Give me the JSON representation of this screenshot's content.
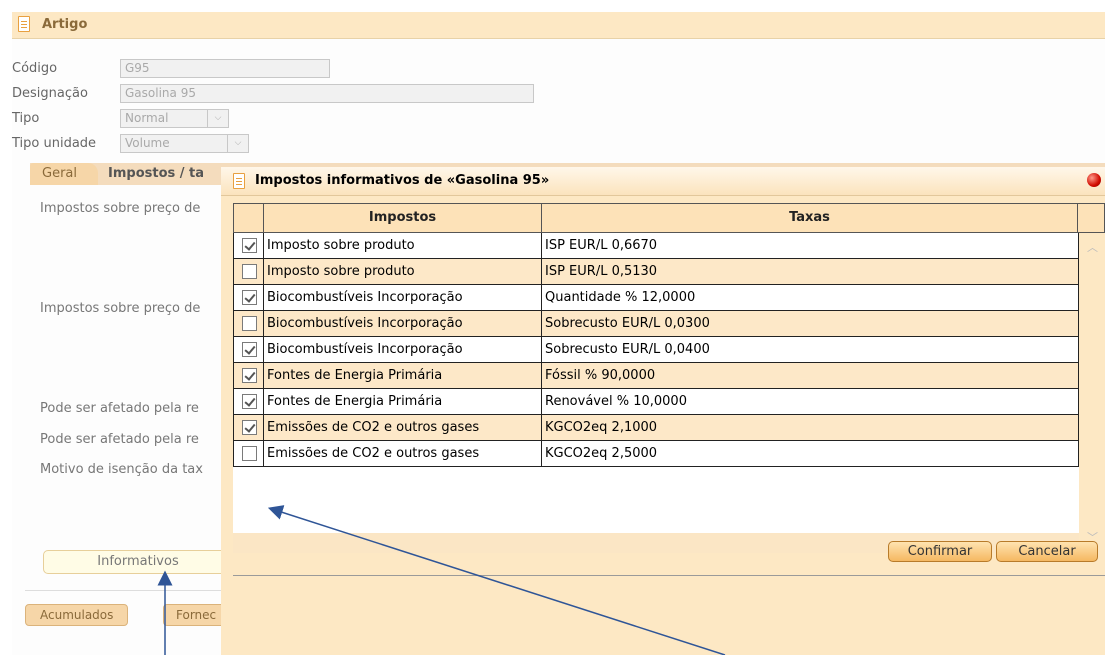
{
  "main": {
    "title": "Artigo",
    "fields": {
      "codigo_label": "Código",
      "codigo_value": "G95",
      "designacao_label": "Designação",
      "designacao_value": "Gasolina 95",
      "tipo_label": "Tipo",
      "tipo_value": "Normal",
      "tipo_unidade_label": "Tipo unidade",
      "tipo_unidade_value": "Volume"
    },
    "tabs": {
      "geral": "Geral",
      "impostos": "Impostos / ta"
    },
    "labels": {
      "impostos1": "Impostos sobre preço de",
      "impostos2": "Impostos sobre preço de",
      "afetado1": "Pode ser afetado pela re",
      "afetado2": "Pode ser afetado pela re",
      "motivo": "Motivo de isenção da tax"
    },
    "informativos_button": "Informativos",
    "bottom_tabs": {
      "acumulados": "Acumulados",
      "fornec": "Fornec"
    }
  },
  "dialog": {
    "title": "Impostos informativos de «Gasolina 95»",
    "columns": [
      "Impostos",
      "Taxas"
    ],
    "rows": [
      {
        "checked": true,
        "imposto": "Imposto sobre produto",
        "taxa": "ISP EUR/L 0,6670"
      },
      {
        "checked": false,
        "imposto": "Imposto sobre produto",
        "taxa": "ISP EUR/L 0,5130"
      },
      {
        "checked": true,
        "imposto": "Biocombustíveis Incorporação",
        "taxa": "Quantidade % 12,0000"
      },
      {
        "checked": false,
        "imposto": "Biocombustíveis Incorporação",
        "taxa": "Sobrecusto EUR/L 0,0300"
      },
      {
        "checked": true,
        "imposto": "Biocombustíveis Incorporação",
        "taxa": "Sobrecusto EUR/L 0,0400"
      },
      {
        "checked": true,
        "imposto": "Fontes de Energia Primária",
        "taxa": "Fóssil % 90,0000"
      },
      {
        "checked": true,
        "imposto": "Fontes de Energia Primária",
        "taxa": "Renovável % 10,0000"
      },
      {
        "checked": true,
        "imposto": "Emissões de CO2 e outros gases",
        "taxa": "KGCO2eq 2,1000"
      },
      {
        "checked": false,
        "imposto": "Emissões de CO2 e outros gases",
        "taxa": "KGCO2eq 2,5000"
      }
    ],
    "confirm_button": "Confirmar",
    "cancel_button": "Cancelar"
  },
  "colors": {
    "accent": "#fde8c4",
    "arrow": "#2f5597",
    "close": "#d10b00"
  },
  "icons": {
    "title_icon": "document-icon",
    "close_icon": "red-dot-close-icon"
  }
}
